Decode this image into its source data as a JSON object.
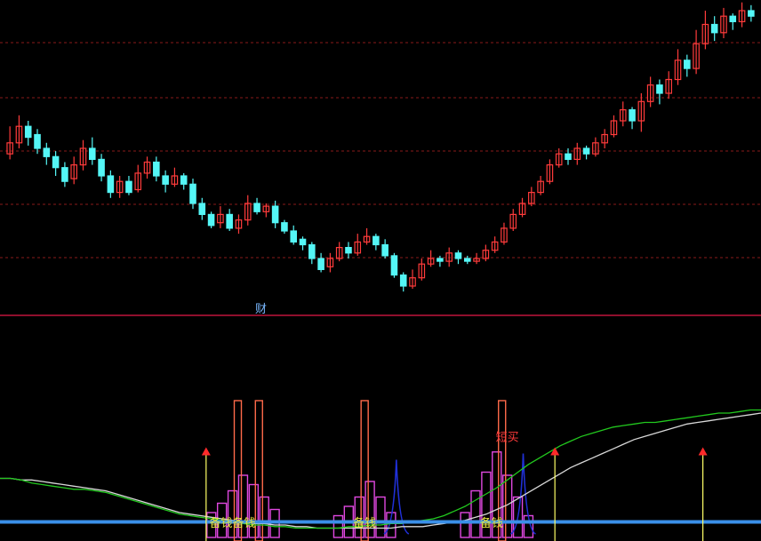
{
  "chart_data": [
    {
      "type": "candlestick",
      "panel": "price",
      "title": "",
      "ylim": [
        0,
        100
      ],
      "colors": {
        "up": "#ff3b3b",
        "down": "#54f6f6",
        "grid": "#8a1a1a"
      },
      "grid": true,
      "candles": [
        {
          "o": 48,
          "c": 52,
          "h": 58,
          "l": 46
        },
        {
          "o": 52,
          "c": 58,
          "h": 62,
          "l": 50
        },
        {
          "o": 58,
          "c": 54,
          "h": 60,
          "l": 51
        },
        {
          "o": 55,
          "c": 50,
          "h": 57,
          "l": 48
        },
        {
          "o": 50,
          "c": 47,
          "h": 52,
          "l": 44
        },
        {
          "o": 47,
          "c": 43,
          "h": 49,
          "l": 40
        },
        {
          "o": 43,
          "c": 38,
          "h": 45,
          "l": 36
        },
        {
          "o": 39,
          "c": 44,
          "h": 47,
          "l": 37
        },
        {
          "o": 44,
          "c": 50,
          "h": 53,
          "l": 42
        },
        {
          "o": 50,
          "c": 46,
          "h": 54,
          "l": 44
        },
        {
          "o": 46,
          "c": 40,
          "h": 48,
          "l": 38
        },
        {
          "o": 40,
          "c": 34,
          "h": 42,
          "l": 32
        },
        {
          "o": 34,
          "c": 38,
          "h": 40,
          "l": 32
        },
        {
          "o": 38,
          "c": 34,
          "h": 40,
          "l": 33
        },
        {
          "o": 35,
          "c": 41,
          "h": 44,
          "l": 34
        },
        {
          "o": 41,
          "c": 45,
          "h": 47,
          "l": 39
        },
        {
          "o": 45,
          "c": 40,
          "h": 47,
          "l": 38
        },
        {
          "o": 40,
          "c": 37,
          "h": 42,
          "l": 34
        },
        {
          "o": 37,
          "c": 40,
          "h": 43,
          "l": 36
        },
        {
          "o": 40,
          "c": 37,
          "h": 41,
          "l": 35
        },
        {
          "o": 37,
          "c": 30,
          "h": 39,
          "l": 28
        },
        {
          "o": 30,
          "c": 26,
          "h": 32,
          "l": 24
        },
        {
          "o": 26,
          "c": 22,
          "h": 27,
          "l": 21
        },
        {
          "o": 23,
          "c": 26,
          "h": 29,
          "l": 21
        },
        {
          "o": 26,
          "c": 21,
          "h": 28,
          "l": 20
        },
        {
          "o": 21,
          "c": 24,
          "h": 26,
          "l": 19
        },
        {
          "o": 24,
          "c": 30,
          "h": 33,
          "l": 22
        },
        {
          "o": 30,
          "c": 27,
          "h": 32,
          "l": 26
        },
        {
          "o": 27,
          "c": 29,
          "h": 30,
          "l": 25
        },
        {
          "o": 29,
          "c": 23,
          "h": 31,
          "l": 21
        },
        {
          "o": 23,
          "c": 20,
          "h": 24,
          "l": 19
        },
        {
          "o": 20,
          "c": 16,
          "h": 22,
          "l": 15
        },
        {
          "o": 17,
          "c": 15,
          "h": 18,
          "l": 13
        },
        {
          "o": 15,
          "c": 10,
          "h": 16,
          "l": 8
        },
        {
          "o": 10,
          "c": 6,
          "h": 12,
          "l": 5
        },
        {
          "o": 7,
          "c": 10,
          "h": 12,
          "l": 5
        },
        {
          "o": 10,
          "c": 14,
          "h": 16,
          "l": 9
        },
        {
          "o": 14,
          "c": 12,
          "h": 16,
          "l": 10
        },
        {
          "o": 12,
          "c": 16,
          "h": 19,
          "l": 11
        },
        {
          "o": 16,
          "c": 18,
          "h": 21,
          "l": 15
        },
        {
          "o": 18,
          "c": 15,
          "h": 19,
          "l": 13
        },
        {
          "o": 15,
          "c": 11,
          "h": 17,
          "l": 10
        },
        {
          "o": 11,
          "c": 4,
          "h": 12,
          "l": 3
        },
        {
          "o": 4,
          "c": 0,
          "h": 5,
          "l": -2
        },
        {
          "o": 0,
          "c": 3,
          "h": 6,
          "l": -1
        },
        {
          "o": 3,
          "c": 8,
          "h": 10,
          "l": 2
        },
        {
          "o": 8,
          "c": 10,
          "h": 13,
          "l": 7
        },
        {
          "o": 10,
          "c": 9,
          "h": 11,
          "l": 7
        },
        {
          "o": 9,
          "c": 12,
          "h": 14,
          "l": 7
        },
        {
          "o": 12,
          "c": 10,
          "h": 13,
          "l": 8
        },
        {
          "o": 10,
          "c": 9,
          "h": 11,
          "l": 8
        },
        {
          "o": 9,
          "c": 10,
          "h": 12,
          "l": 8
        },
        {
          "o": 10,
          "c": 13,
          "h": 15,
          "l": 9
        },
        {
          "o": 13,
          "c": 16,
          "h": 18,
          "l": 12
        },
        {
          "o": 16,
          "c": 21,
          "h": 23,
          "l": 15
        },
        {
          "o": 21,
          "c": 26,
          "h": 28,
          "l": 20
        },
        {
          "o": 26,
          "c": 30,
          "h": 32,
          "l": 25
        },
        {
          "o": 30,
          "c": 34,
          "h": 36,
          "l": 29
        },
        {
          "o": 34,
          "c": 38,
          "h": 40,
          "l": 33
        },
        {
          "o": 38,
          "c": 44,
          "h": 46,
          "l": 37
        },
        {
          "o": 44,
          "c": 48,
          "h": 50,
          "l": 43
        },
        {
          "o": 48,
          "c": 46,
          "h": 50,
          "l": 44
        },
        {
          "o": 46,
          "c": 50,
          "h": 52,
          "l": 44
        },
        {
          "o": 50,
          "c": 48,
          "h": 51,
          "l": 46
        },
        {
          "o": 48,
          "c": 52,
          "h": 54,
          "l": 47
        },
        {
          "o": 52,
          "c": 55,
          "h": 57,
          "l": 50
        },
        {
          "o": 55,
          "c": 60,
          "h": 62,
          "l": 54
        },
        {
          "o": 60,
          "c": 64,
          "h": 67,
          "l": 58
        },
        {
          "o": 64,
          "c": 60,
          "h": 65,
          "l": 57
        },
        {
          "o": 60,
          "c": 67,
          "h": 70,
          "l": 56
        },
        {
          "o": 67,
          "c": 73,
          "h": 76,
          "l": 65
        },
        {
          "o": 73,
          "c": 70,
          "h": 75,
          "l": 66
        },
        {
          "o": 70,
          "c": 75,
          "h": 78,
          "l": 68
        },
        {
          "o": 75,
          "c": 82,
          "h": 86,
          "l": 73
        },
        {
          "o": 82,
          "c": 79,
          "h": 84,
          "l": 76
        },
        {
          "o": 79,
          "c": 88,
          "h": 93,
          "l": 77
        },
        {
          "o": 88,
          "c": 95,
          "h": 100,
          "l": 86
        },
        {
          "o": 95,
          "c": 92,
          "h": 98,
          "l": 89
        },
        {
          "o": 92,
          "c": 98,
          "h": 101,
          "l": 90
        },
        {
          "o": 98,
          "c": 96,
          "h": 99,
          "l": 93
        },
        {
          "o": 96,
          "c": 100,
          "h": 103,
          "l": 94
        },
        {
          "o": 100,
          "c": 98,
          "h": 102,
          "l": 96
        }
      ]
    },
    {
      "type": "indicator",
      "panel": "indicator",
      "title": "",
      "ylim": [
        0,
        100
      ],
      "colors": {
        "green": "#22c81e",
        "white": "#d8d8d8",
        "blue": "#3a8fe8",
        "orange": "#ff6a4a",
        "magenta": "#e048e0",
        "navy": "#2030d8",
        "arrow": "#ff2a2a",
        "yellow": "#ffff66",
        "divider": "#c0143c",
        "yellow_text": "#e8e840",
        "red_text": "#ff3b3b",
        "blue_text": "#7ab8ff"
      },
      "green_line": [
        38,
        38,
        37,
        35,
        34,
        33,
        32,
        31,
        31,
        30,
        29,
        27,
        25,
        23,
        21,
        19,
        17,
        15,
        14,
        13,
        12,
        11,
        10,
        9,
        8,
        8,
        7,
        7,
        6,
        6,
        6,
        6,
        6,
        7,
        7,
        8,
        8,
        9,
        9,
        10,
        11,
        12,
        14,
        17,
        20,
        24,
        28,
        32,
        37,
        42,
        47,
        51,
        55,
        59,
        62,
        65,
        67,
        69,
        71,
        72,
        73,
        74,
        74,
        75,
        76,
        77,
        78,
        79,
        80,
        80,
        81,
        82,
        82
      ],
      "white_line": [
        38,
        38,
        37,
        37,
        36,
        35,
        34,
        33,
        32,
        31,
        30,
        28,
        26,
        24,
        22,
        20,
        18,
        16,
        15,
        14,
        13,
        12,
        11,
        10,
        9,
        9,
        8,
        8,
        7,
        7,
        6,
        6,
        6,
        6,
        6,
        6,
        6,
        6,
        7,
        7,
        7,
        8,
        9,
        10,
        11,
        13,
        15,
        18,
        21,
        25,
        29,
        33,
        37,
        41,
        45,
        48,
        51,
        54,
        57,
        60,
        63,
        65,
        67,
        69,
        71,
        73,
        74,
        75,
        76,
        77,
        78,
        79,
        80
      ],
      "orange_bars": [
        {
          "x": 22.5,
          "v": 88
        },
        {
          "x": 24.5,
          "v": 88
        },
        {
          "x": 34.5,
          "v": 88
        },
        {
          "x": 47.5,
          "v": 88
        }
      ],
      "magenta_bars": [
        {
          "x": 20,
          "v": 16
        },
        {
          "x": 21,
          "v": 22
        },
        {
          "x": 22,
          "v": 30
        },
        {
          "x": 23,
          "v": 40
        },
        {
          "x": 24,
          "v": 34
        },
        {
          "x": 25,
          "v": 26
        },
        {
          "x": 26,
          "v": 18
        },
        {
          "x": 32,
          "v": 14
        },
        {
          "x": 33,
          "v": 20
        },
        {
          "x": 34,
          "v": 26
        },
        {
          "x": 35,
          "v": 36
        },
        {
          "x": 36,
          "v": 26
        },
        {
          "x": 37,
          "v": 16
        },
        {
          "x": 44,
          "v": 16
        },
        {
          "x": 45,
          "v": 30
        },
        {
          "x": 46,
          "v": 42
        },
        {
          "x": 47,
          "v": 55
        },
        {
          "x": 48,
          "v": 40
        },
        {
          "x": 49,
          "v": 26
        },
        {
          "x": 50,
          "v": 14
        }
      ],
      "navy_spikes": [
        {
          "x": 37.5,
          "v": 50
        },
        {
          "x": 49.5,
          "v": 54
        }
      ],
      "arrows": [
        {
          "x": 19.5,
          "v": 58
        },
        {
          "x": 52.5,
          "v": 58
        },
        {
          "x": 66.5,
          "v": 58
        },
        {
          "x": 73.5,
          "v": 58
        }
      ],
      "blue_baseline": 10,
      "texts": [
        {
          "text": "备钱备钱",
          "x": 22,
          "v": 7,
          "color": "yellow_text"
        },
        {
          "text": "备钱",
          "x": 34.5,
          "v": 7,
          "color": "yellow_text"
        },
        {
          "text": "备钱",
          "x": 46.5,
          "v": 7,
          "color": "yellow_text"
        },
        {
          "text": "短买",
          "x": 48,
          "v": 62,
          "color": "red_text"
        }
      ],
      "divider_label": "财"
    }
  ]
}
